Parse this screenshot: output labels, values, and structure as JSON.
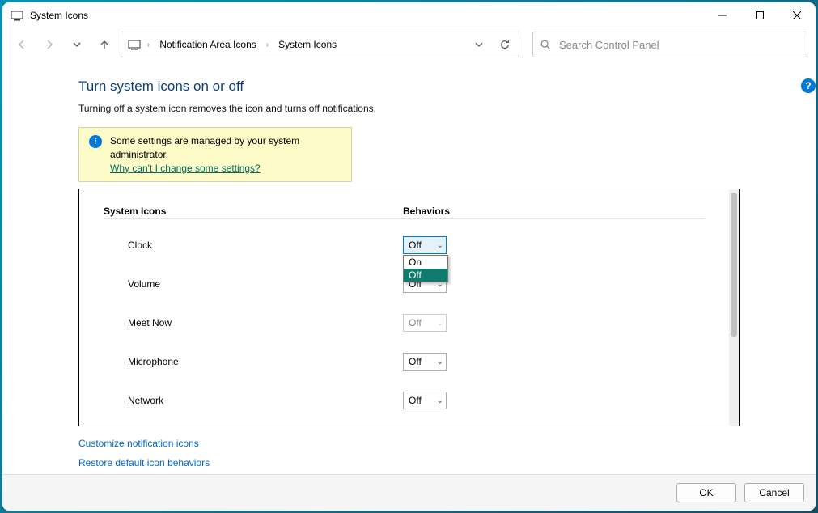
{
  "titlebar": {
    "title": "System Icons"
  },
  "breadcrumb": {
    "items": [
      "Notification Area Icons",
      "System Icons"
    ]
  },
  "search": {
    "placeholder": "Search Control Panel"
  },
  "page": {
    "heading": "Turn system icons on or off",
    "subheading": "Turning off a system icon removes the icon and turns off notifications.",
    "banner_msg": "Some settings are managed by your system administrator.",
    "banner_link": "Why can't I change some settings?"
  },
  "table": {
    "col_icons": "System Icons",
    "col_behav": "Behaviors",
    "rows": [
      {
        "label": "Clock",
        "value": "Off",
        "open": true,
        "disabled": false
      },
      {
        "label": "Volume",
        "value": "Off",
        "open": false,
        "disabled": false
      },
      {
        "label": "Meet Now",
        "value": "Off",
        "open": false,
        "disabled": true
      },
      {
        "label": "Microphone",
        "value": "Off",
        "open": false,
        "disabled": false
      },
      {
        "label": "Network",
        "value": "Off",
        "open": false,
        "disabled": false
      }
    ],
    "options": [
      "On",
      "Off"
    ],
    "selected_option": "Off"
  },
  "links": {
    "customize": "Customize notification icons",
    "restore": "Restore default icon behaviors"
  },
  "footer": {
    "ok": "OK",
    "cancel": "Cancel"
  }
}
